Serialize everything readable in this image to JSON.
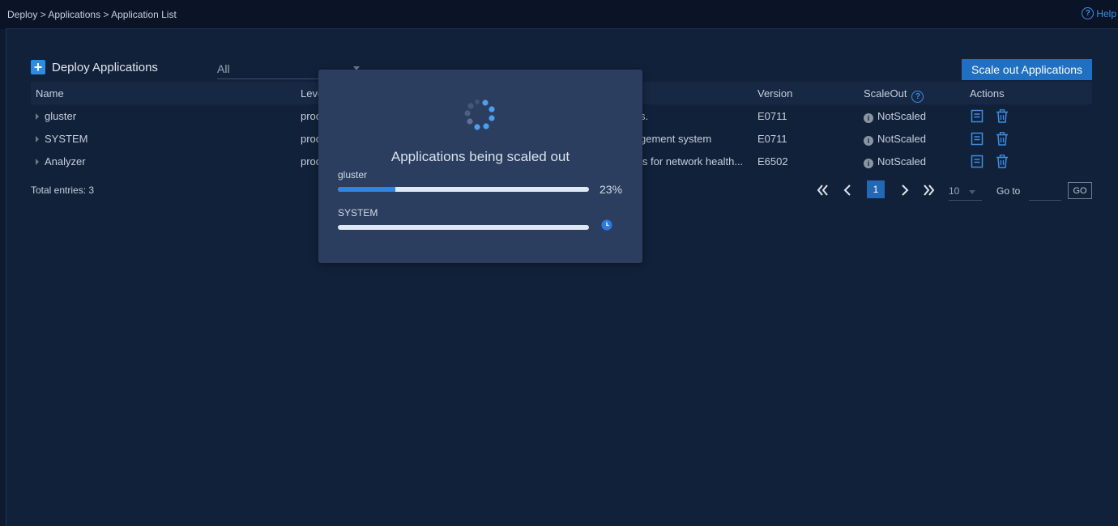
{
  "breadcrumb": "Deploy > Applications > Application List",
  "help": {
    "label": "Help",
    "icon": "question-circle-icon"
  },
  "section": {
    "title": "Deploy Applications",
    "icon": "plus-square-icon"
  },
  "filter": {
    "selected": "All"
  },
  "scale_out_button": "Scale out Applications",
  "table": {
    "columns": {
      "name": "Name",
      "level": "Leve",
      "version": "Version",
      "scaleout": "ScaleOut",
      "actions": "Actions"
    },
    "rows": [
      {
        "name": "gluster",
        "level": "proc",
        "description": "s.",
        "version": "E0711",
        "scaleout": "NotScaled"
      },
      {
        "name": "SYSTEM",
        "level": "proc",
        "description": "gement system",
        "version": "E0711",
        "scaleout": "NotScaled"
      },
      {
        "name": "Analyzer",
        "level": "proc",
        "description": "is for network health...",
        "version": "E6502",
        "scaleout": "NotScaled"
      }
    ]
  },
  "pagination": {
    "total": "Total entries: 3",
    "current_page": "1",
    "page_size": "10",
    "goto_label": "Go to",
    "go_button": "GO"
  },
  "modal": {
    "title": "Applications being scaled out",
    "items": [
      {
        "name": "gluster",
        "progress": 0.23,
        "percent_text": "23%",
        "status": "in-progress"
      },
      {
        "name": "SYSTEM",
        "progress": 0,
        "status": "pending",
        "status_icon": "clock-icon"
      }
    ]
  },
  "colors": {
    "accent": "#2e86e3",
    "button": "#1f6fc2",
    "background": "#0e1a30",
    "modal": "#2b3e5f"
  }
}
